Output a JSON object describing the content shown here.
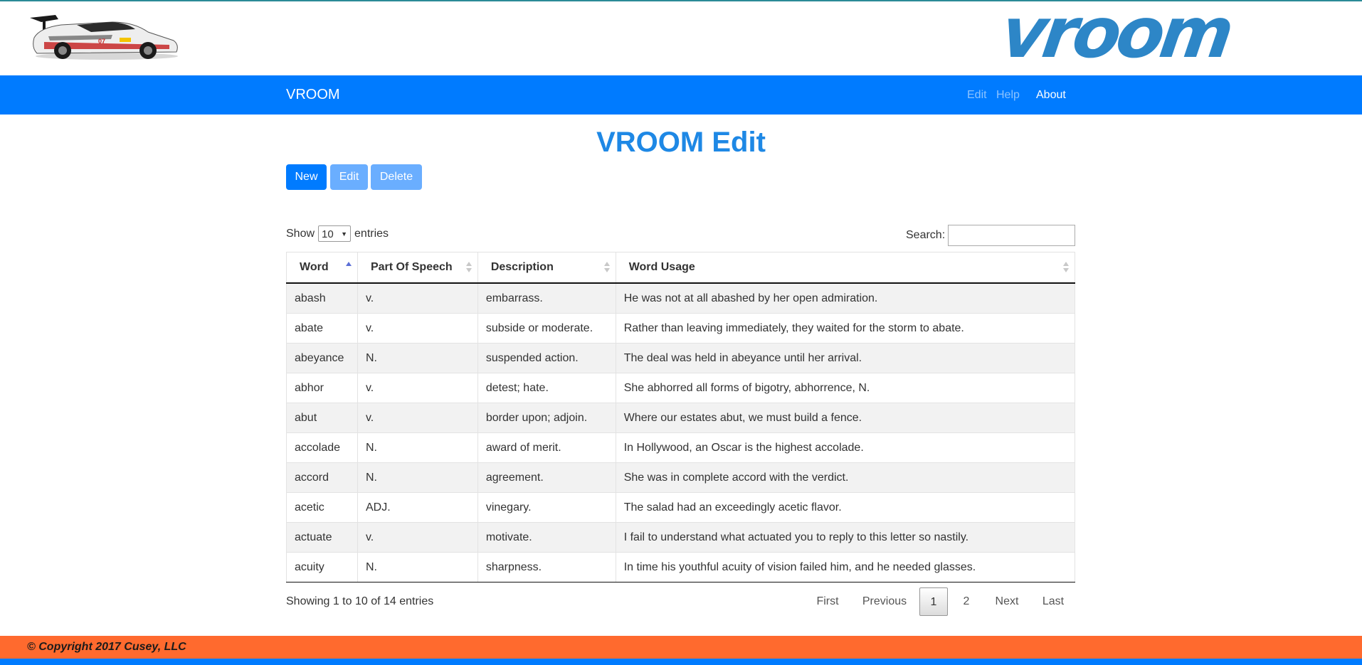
{
  "brand": {
    "logo_text": "vroom"
  },
  "navbar": {
    "brand": "VROOM",
    "links": [
      "Edit",
      "Help",
      "About"
    ]
  },
  "page": {
    "title": "VROOM Edit"
  },
  "toolbar": {
    "new_label": "New",
    "edit_label": "Edit",
    "delete_label": "Delete"
  },
  "table_controls": {
    "show_label": "Show",
    "page_length": "10",
    "entries_label": "entries",
    "search_label": "Search:",
    "search_value": ""
  },
  "table": {
    "columns": [
      "Word",
      "Part Of Speech",
      "Description",
      "Word Usage"
    ],
    "sorted_column": "Word",
    "rows": [
      [
        "abash",
        "v.",
        "embarrass.",
        "He was not at all abashed by her open admiration."
      ],
      [
        "abate",
        "v.",
        "subside or moderate.",
        "Rather than leaving immediately, they waited for the storm to abate."
      ],
      [
        "abeyance",
        "N.",
        "suspended action.",
        "The deal was held in abeyance until her arrival."
      ],
      [
        "abhor",
        "v.",
        "detest; hate.",
        "She abhorred all forms of bigotry, abhorrence, N."
      ],
      [
        "abut",
        "v.",
        "border upon; adjoin.",
        "Where our estates abut, we must build a fence."
      ],
      [
        "accolade",
        "N.",
        "award of merit.",
        "In Hollywood, an Oscar is the highest accolade."
      ],
      [
        "accord",
        "N.",
        "agreement.",
        "She was in complete accord with the verdict."
      ],
      [
        "acetic",
        "ADJ.",
        "vinegary.",
        "The salad had an exceedingly acetic flavor."
      ],
      [
        "actuate",
        "v.",
        "motivate.",
        "I fail to understand what actuated you to reply to this letter so nastily."
      ],
      [
        "acuity",
        "N.",
        "sharpness.",
        "In time his youthful acuity of vision failed him, and he needed glasses."
      ]
    ],
    "info": "Showing 1 to 10 of 14 entries"
  },
  "pagination": {
    "first": "First",
    "previous": "Previous",
    "pages": [
      "1",
      "2"
    ],
    "current": "1",
    "next": "Next",
    "last": "Last"
  },
  "footer": {
    "copyright": "© Copyright 2017 Cusey, LLC"
  },
  "colors": {
    "primary": "#007bff",
    "primary_light": "#6aaeff",
    "title": "#1e88e5",
    "logo": "#2d86c7",
    "footer": "#ff6a2e"
  }
}
